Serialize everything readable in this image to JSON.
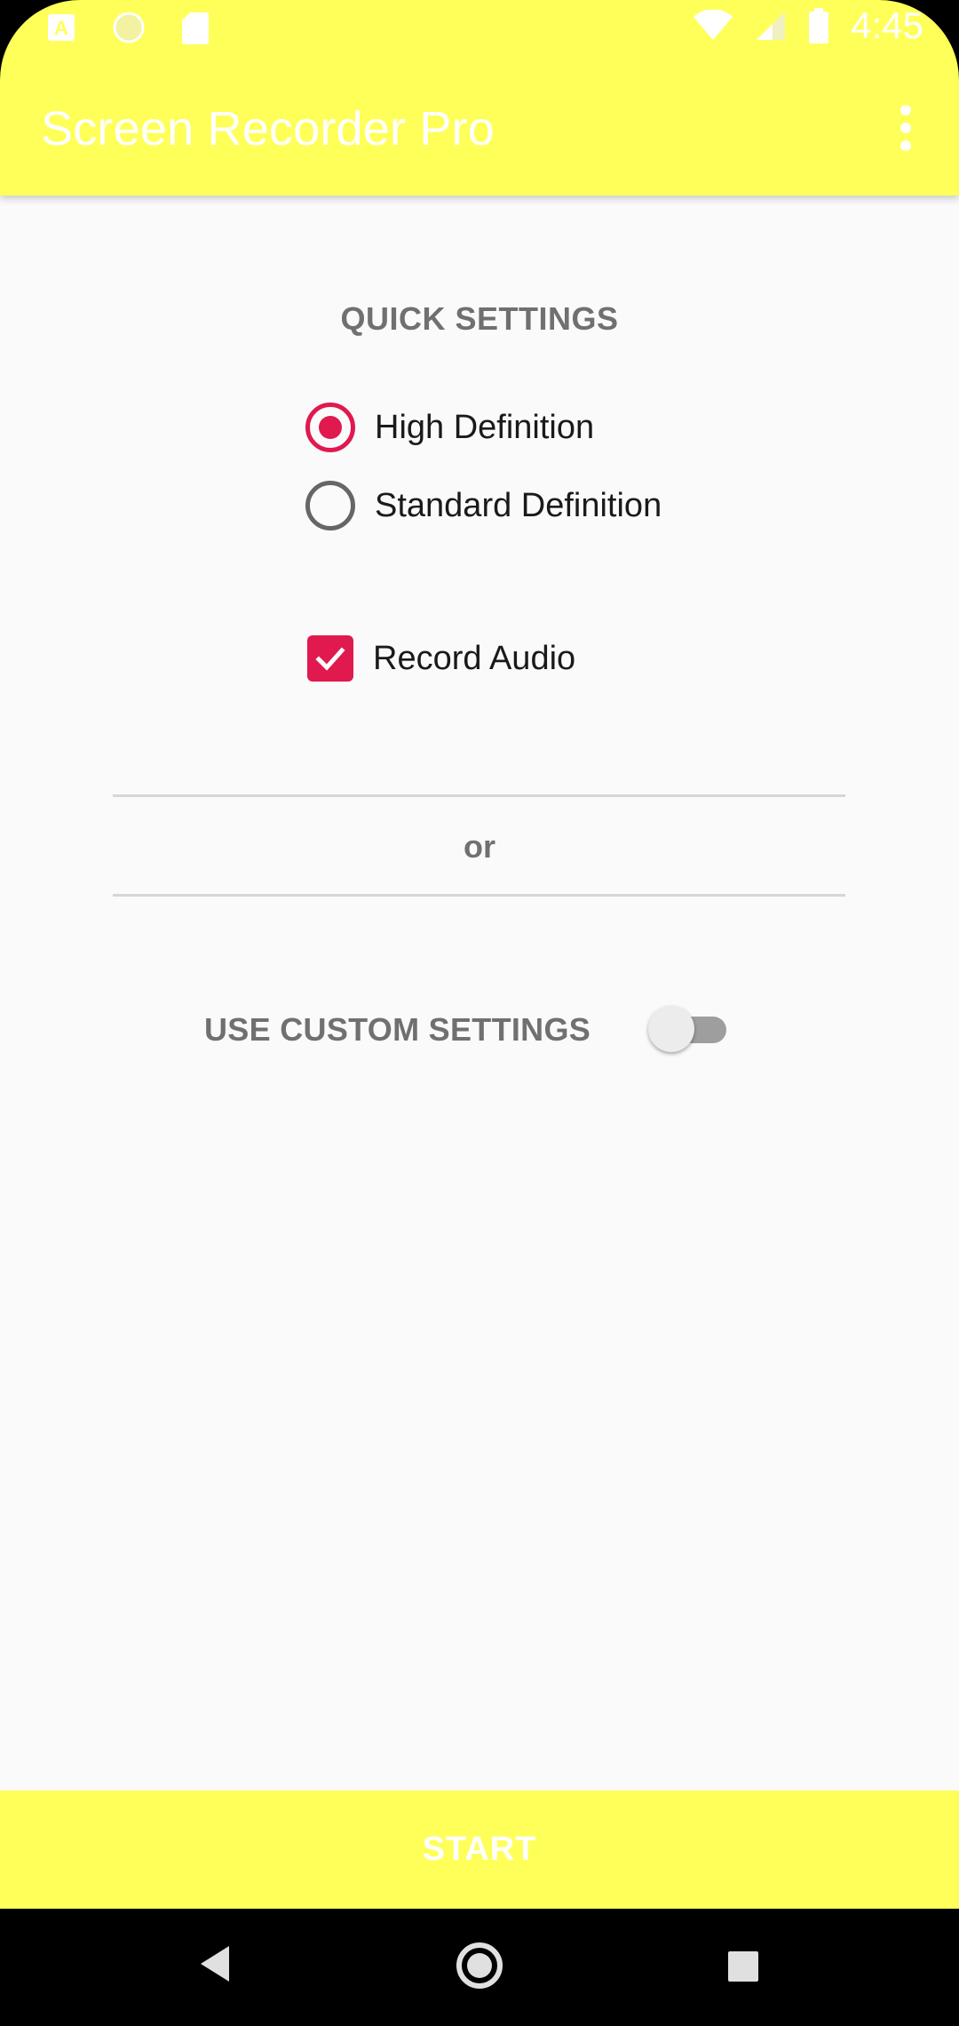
{
  "status_bar": {
    "time": "4:45",
    "left_icons": [
      "a-badge-icon",
      "circle-icon",
      "sd-card-icon"
    ],
    "right_icons": [
      "wifi-icon",
      "signal-icon",
      "battery-icon"
    ]
  },
  "app_bar": {
    "title": "Screen Recorder Pro",
    "menu_icon": "more-vert-icon"
  },
  "quick_settings": {
    "title": "QUICK SETTINGS",
    "quality_options": [
      {
        "label": "High Definition",
        "selected": true
      },
      {
        "label": "Standard Definition",
        "selected": false
      }
    ],
    "record_audio": {
      "label": "Record Audio",
      "checked": true
    }
  },
  "separator": {
    "text": "or"
  },
  "custom_settings": {
    "label": "USE CUSTOM SETTINGS",
    "enabled": false
  },
  "actions": {
    "start_label": "START"
  },
  "nav_bar": {
    "icons": [
      "back-icon",
      "home-icon",
      "recents-icon"
    ]
  },
  "colors": {
    "accent": "#e0194f",
    "bar_background": "#ffff5a",
    "content_background": "#fafafa",
    "secondary_text": "#707070"
  }
}
